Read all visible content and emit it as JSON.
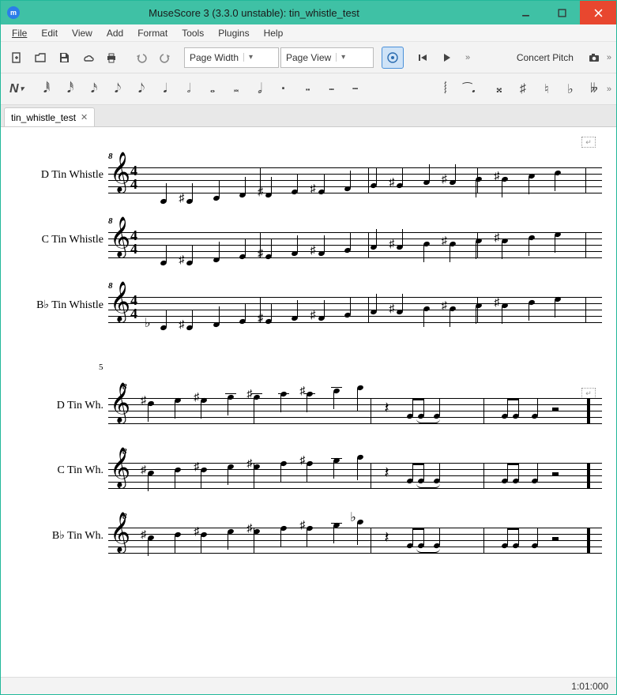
{
  "window": {
    "title": "MuseScore 3 (3.3.0 unstable): tin_whistle_test",
    "app_icon_label": "m"
  },
  "menu": {
    "items": [
      "File",
      "Edit",
      "View",
      "Add",
      "Format",
      "Tools",
      "Plugins",
      "Help"
    ]
  },
  "toolbar1": {
    "zoom_combo": "Page Width",
    "view_combo": "Page View",
    "concert_pitch_label": "Concert Pitch"
  },
  "toolbar2": {
    "note_entry_label": "N"
  },
  "tabs": {
    "items": [
      {
        "label": "tin_whistle_test"
      }
    ]
  },
  "score": {
    "system1": {
      "staves": [
        {
          "label": "D Tin Whistle",
          "clef": "𝄞",
          "time_top": "4",
          "time_bot": "4",
          "oct": "8"
        },
        {
          "label": "C Tin Whistle",
          "clef": "𝄞",
          "time_top": "4",
          "time_bot": "4",
          "oct": "8"
        },
        {
          "label": "B♭ Tin Whistle",
          "clef": "𝄞",
          "time_top": "4",
          "time_bot": "4",
          "oct": "8"
        }
      ]
    },
    "system2": {
      "measure_num": "5",
      "staves": [
        {
          "label": "D Tin Wh.",
          "clef": "𝄞",
          "oct": "8"
        },
        {
          "label": "C Tin Wh.",
          "clef": "𝄞",
          "oct": "8"
        },
        {
          "label": "B♭ Tin Wh.",
          "clef": "𝄞",
          "oct": "8"
        }
      ]
    }
  },
  "statusbar": {
    "position": "1:01:000"
  }
}
